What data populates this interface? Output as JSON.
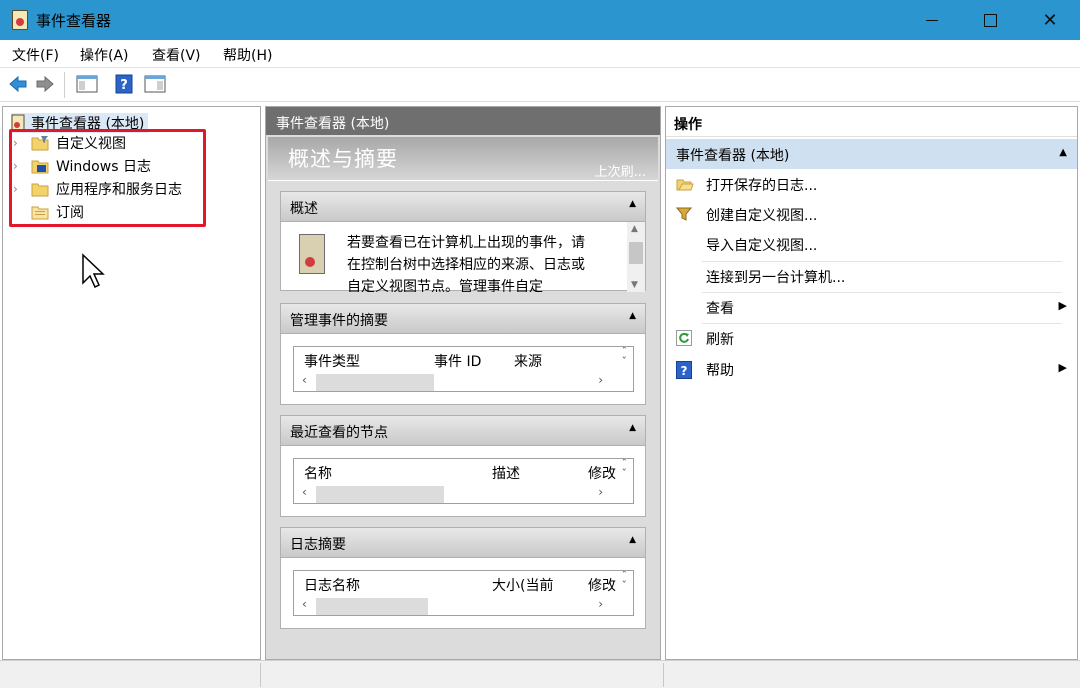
{
  "window": {
    "title": "事件查看器"
  },
  "menu": {
    "file": "文件(F)",
    "action": "操作(A)",
    "view": "查看(V)",
    "help": "帮助(H)"
  },
  "toolbar": {
    "icons": [
      "back-arrow-icon",
      "forward-arrow-icon",
      "show-hide-tree-icon",
      "help-icon",
      "show-hide-action-pane-icon"
    ]
  },
  "tree": {
    "root": "事件查看器 (本地)",
    "items": [
      {
        "label": "自定义视图",
        "icon": "folder-filter-icon"
      },
      {
        "label": "Windows 日志",
        "icon": "windows-log-icon"
      },
      {
        "label": "应用程序和服务日志",
        "icon": "folder-icon"
      },
      {
        "label": "订阅",
        "icon": "subscription-icon"
      }
    ]
  },
  "middle": {
    "header": "事件查看器 (本地)",
    "banner_title": "概述与摘要",
    "banner_last_refresh": "上次刷...",
    "overview": {
      "title": "概述",
      "text": "若要查看已在计算机上出现的事件，请在控制台树中选择相应的来源、日志或自定义视图节点。管理事件自定"
    },
    "admin_events": {
      "title": "管理事件的摘要",
      "columns": [
        "事件类型",
        "事件 ID",
        "来源"
      ]
    },
    "recent_nodes": {
      "title": "最近查看的节点",
      "columns": [
        "名称",
        "描述",
        "修改"
      ]
    },
    "log_summary": {
      "title": "日志摘要",
      "columns": [
        "日志名称",
        "大小(当前",
        "修改"
      ]
    }
  },
  "actions": {
    "header": "操作",
    "group": "事件查看器 (本地)",
    "items": [
      {
        "label": "打开保存的日志...",
        "icon": "open-log-folder-icon"
      },
      {
        "label": "创建自定义视图...",
        "icon": "filter-funnel-icon"
      },
      {
        "label": "导入自定义视图...",
        "icon": ""
      },
      {
        "label": "连接到另一台计算机...",
        "icon": ""
      },
      {
        "label": "查看",
        "icon": ""
      },
      {
        "label": "刷新",
        "icon": "refresh-icon"
      },
      {
        "label": "帮助",
        "icon": "help-icon"
      }
    ]
  },
  "colors": {
    "titlebar": "#2b95d0",
    "selection": "#cfe0f1",
    "highlight_box": "#e3172b",
    "pane_header": "#6f6f6f"
  }
}
